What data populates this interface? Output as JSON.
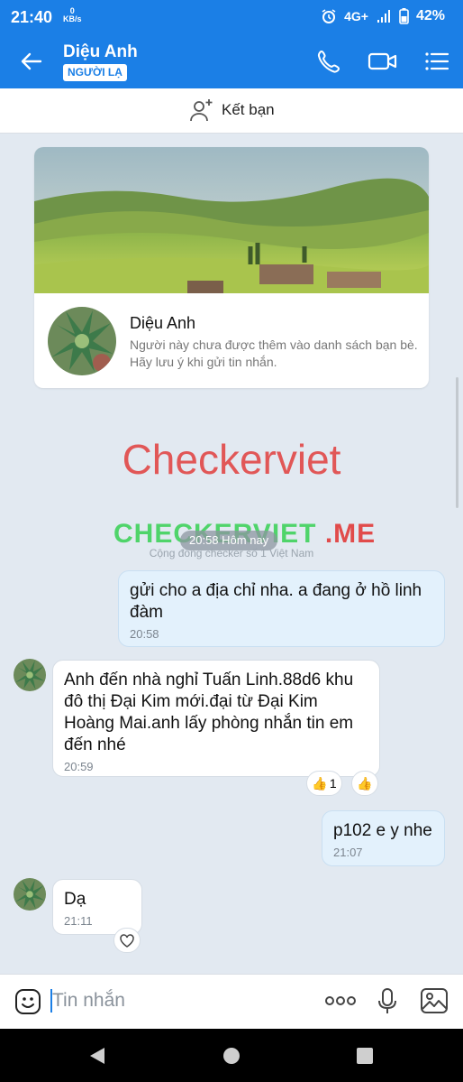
{
  "status": {
    "time": "21:40",
    "net_speed": "0",
    "net_unit": "KB/s",
    "signal": "4G+",
    "battery": "42%"
  },
  "header": {
    "contact_name": "Diệu Anh",
    "tag": "NGƯỜI LẠ"
  },
  "add_friend": {
    "label": "Kết bạn"
  },
  "profile_card": {
    "name": "Diệu Anh",
    "note": "Người này chưa được thêm vào danh sách bạn bè. Hãy lưu ý khi gửi tin nhắn."
  },
  "watermark": {
    "title": "Checkerviet",
    "brand_green": "CHECKERVIET",
    "brand_red": ".ME",
    "tagline": "Cộng đồng checker số 1 Việt Nam"
  },
  "date_separator": "20:58 Hôm nay",
  "messages": [
    {
      "from": "me",
      "text": "gửi cho a địa chỉ nha. a đang ở hồ linh đàm",
      "time": "20:58"
    },
    {
      "from": "them",
      "text": "Anh đến nhà nghỉ Tuấn Linh.88d6 khu đô thị Đại Kim mới.đại từ Đại Kim Hoàng Mai.anh lấy phòng nhắn tin em đến nhé",
      "time": "20:59",
      "reaction_count": "1"
    },
    {
      "from": "me",
      "text": "p102 e y nhe",
      "time": "21:07"
    },
    {
      "from": "them",
      "text": "Dạ",
      "time": "21:11"
    }
  ],
  "composer": {
    "placeholder": "Tin nhắn"
  },
  "colors": {
    "header": "#1b7fe6",
    "chat_bg": "#e2e9f1",
    "my_bubble": "#e3f1fc",
    "watermark_red": "#e14b4b",
    "watermark_green": "#4fd46a"
  },
  "icons": [
    "back-arrow-icon",
    "phone-icon",
    "video-call-icon",
    "menu-icon",
    "add-friend-icon",
    "emoji-icon",
    "more-icon",
    "microphone-icon",
    "image-icon",
    "thumbs-up-icon",
    "heart-icon"
  ]
}
